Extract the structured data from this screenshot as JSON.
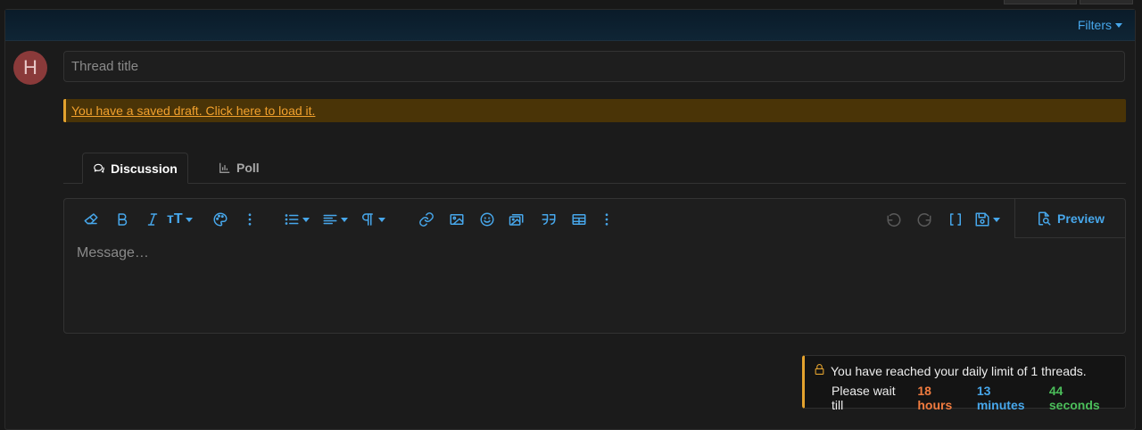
{
  "header": {
    "filters_label": "Filters"
  },
  "avatar": {
    "initial": "H"
  },
  "thread_title": {
    "placeholder": "Thread title",
    "value": ""
  },
  "draft": {
    "message": "You have a saved draft. Click here to load it."
  },
  "tabs": [
    {
      "label": "Discussion",
      "icon": "comments-icon",
      "active": true
    },
    {
      "label": "Poll",
      "icon": "bar-chart-icon",
      "active": false
    }
  ],
  "editor": {
    "message_placeholder": "Message…",
    "font_size_glyph": "тT",
    "preview_label": "Preview"
  },
  "limit_notice": {
    "message": "You have reached your daily limit of 1 threads.",
    "wait_prefix": "Please wait till",
    "hours": "18 hours",
    "minutes": "13 minutes",
    "seconds": "44 seconds",
    "colors": {
      "hours": "#f07b3f",
      "minutes": "#47a7eb",
      "seconds": "#4bbe5a",
      "accent": "#e3a22e"
    }
  }
}
